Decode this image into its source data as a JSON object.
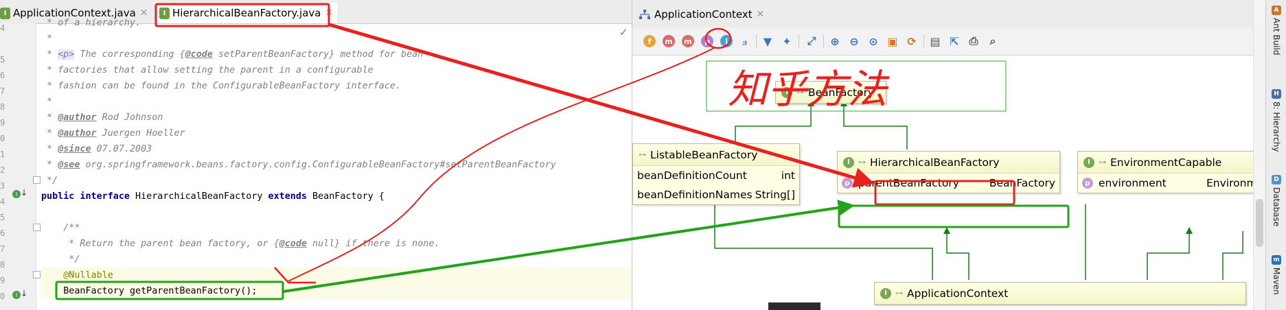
{
  "editor": {
    "tabs": [
      {
        "label": "ApplicationContext.java",
        "icon": "interface-icon",
        "active": false
      },
      {
        "label": "HierarchicalBeanFactory.java",
        "icon": "interface-icon",
        "active": true
      }
    ],
    "line_numbers": [
      "4",
      "5",
      "6",
      "7",
      "8",
      "9",
      "0",
      "1",
      "2",
      "3",
      "4",
      "5",
      "6",
      "7",
      "8",
      "9",
      "0"
    ],
    "code_lines": {
      "l0": " * of a hierarchy.",
      "l1": " *",
      "l2a": " * ",
      "l2tag": "<p>",
      "l2b": " The corresponding {",
      "l2code": "@code",
      "l2c": " setParentBeanFactory} method for bean",
      "l3": " * factories that allow setting the parent in a configurable",
      "l4": " * fashion can be found in the ConfigurableBeanFactory interface.",
      "l5": " *",
      "l6a": " * ",
      "l6tag": "@author",
      "l6b": " Rod Johnson",
      "l7a": " * ",
      "l7tag": "@author",
      "l7b": " Juergen Hoeller",
      "l8a": " * ",
      "l8tag": "@since",
      "l8b": " 07.07.2003",
      "l9a": " * ",
      "l9tag": "@see",
      "l9b": " org.springframework.beans.factory.config.ConfigurableBeanFactory#setParentBeanFactory",
      "l10": " */",
      "l11kw1": "public interface",
      "l11a": " HierarchicalBeanFactory ",
      "l11kw2": "extends",
      "l11b": " BeanFactory {",
      "l13": "    /**",
      "l14a": "     * Return the parent bean factory, or {",
      "l14code": "@code",
      "l14b": " null} if there is none.",
      "l15": "     */",
      "l16": "    @Nullable",
      "l17": "    BeanFactory getParentBeanFactory();"
    }
  },
  "diagram": {
    "tab": {
      "label": "ApplicationContext",
      "icon": "hierarchy-icon"
    },
    "toolbar": {
      "circles": [
        {
          "letter": "f",
          "color": "#e8a23c",
          "name": "fields-filter-icon"
        },
        {
          "letter": "m",
          "color": "#d86a6a",
          "name": "constructors-filter-icon"
        },
        {
          "letter": "m",
          "color": "#d86a6a",
          "name": "methods-filter-icon"
        },
        {
          "letter": "p",
          "color": "#b37ed1",
          "name": "properties-filter-icon"
        },
        {
          "letter": "I",
          "color": "#4aa0d8",
          "name": "inner-classes-filter-icon"
        }
      ]
    },
    "nodes": {
      "beanfactory": {
        "title": "BeanFactory"
      },
      "listable": {
        "title": "ListableBeanFactory",
        "rows": [
          {
            "name": "beanDefinitionCount",
            "type": "int"
          },
          {
            "name": "beanDefinitionNames",
            "type": "String[]"
          }
        ]
      },
      "hierarchical": {
        "title": "HierarchicalBeanFactory",
        "rows": [
          {
            "name": "parentBeanFactory",
            "type": "BeanFactory"
          }
        ]
      },
      "environment": {
        "title": "EnvironmentCapable",
        "rows": [
          {
            "name": "environment",
            "type": "Environment"
          }
        ]
      },
      "appctx": {
        "title": "ApplicationContext"
      }
    },
    "handwriting": "知乎方法"
  },
  "sidebar": {
    "tabs": [
      {
        "label": "Ant Build"
      },
      {
        "label": "8: Hierarchy"
      },
      {
        "label": "Database"
      },
      {
        "label": "Maven"
      }
    ]
  },
  "colors": {
    "annotation_red": "#e8201e",
    "annotation_green": "#22a31a",
    "interface_green": "#77a85c",
    "property_purple": "#c698d8"
  }
}
